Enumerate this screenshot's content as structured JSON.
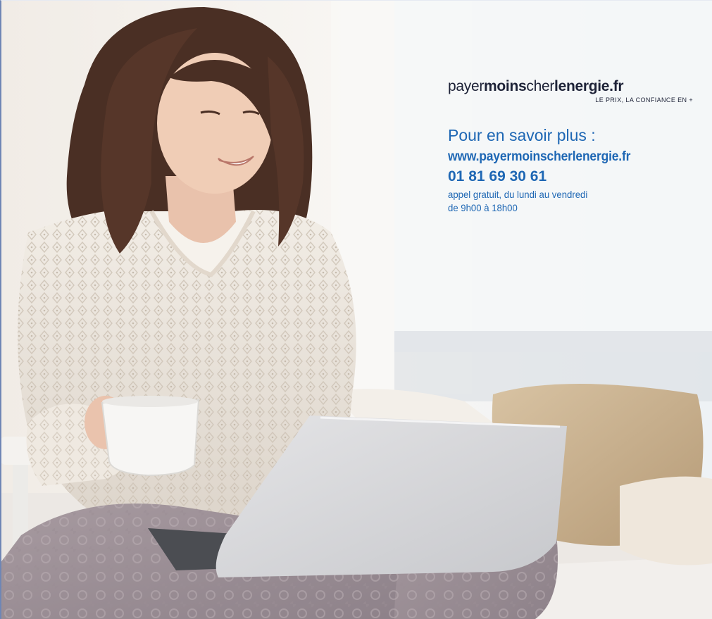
{
  "logo": {
    "part1": "payer",
    "part2": "moins",
    "part3": "cher",
    "part4": "lenergie",
    "part5": ".fr",
    "tagline": "LE PRIX, LA CONFIANCE EN +"
  },
  "contact": {
    "title": "Pour en savoir plus :",
    "website": "www.payermoinscherlenergie.fr",
    "phone": "01 81 69 30 61",
    "note_line1": "appel gratuit, du lundi au vendredi",
    "note_line2": "de 9h00 à 18h00"
  },
  "colors": {
    "brand_blue": "#1e67b4",
    "logo_dark": "#1d2237"
  },
  "photo": {
    "subject": "woman-with-laptop-and-cup"
  }
}
